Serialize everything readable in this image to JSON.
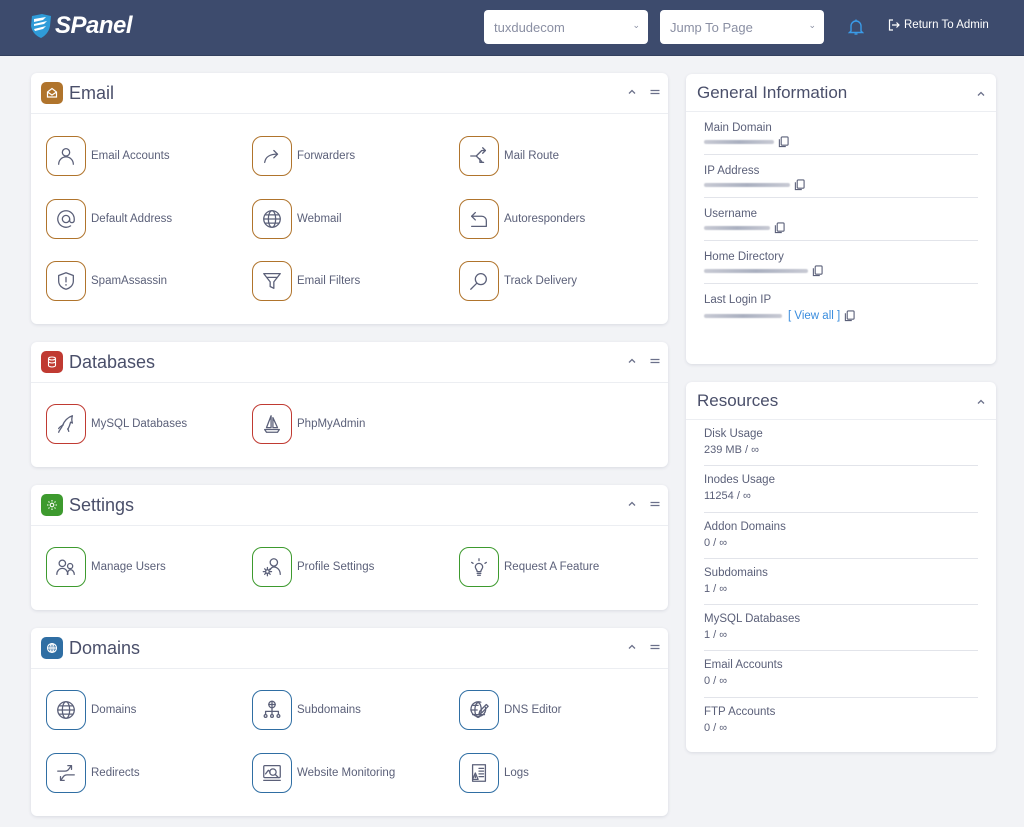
{
  "header": {
    "brand": "SPanel",
    "domain_select": {
      "value": "tuxdudecom",
      "caret": "⌄"
    },
    "jump_select": {
      "placeholder": "Jump To Page",
      "caret": "⌄"
    },
    "return_label": "Return To Admin"
  },
  "colors": {
    "email": "#b0742c",
    "databases": "#c03a32",
    "settings": "#3d9a2e",
    "domains": "#2f6ea3",
    "link": "#3a8dde",
    "topbar": "#3d4b6d"
  },
  "sections": {
    "email": {
      "title": "Email",
      "items": [
        {
          "label": "Email Accounts",
          "icon": "user-icon"
        },
        {
          "label": "Forwarders",
          "icon": "forward-arrow-icon"
        },
        {
          "label": "Mail Route",
          "icon": "route-split-icon"
        },
        {
          "label": "Default Address",
          "icon": "at-sign-icon"
        },
        {
          "label": "Webmail",
          "icon": "globe-icon"
        },
        {
          "label": "Autoresponders",
          "icon": "reply-arrow-icon"
        },
        {
          "label": "SpamAssassin",
          "icon": "shield-alert-icon"
        },
        {
          "label": "Email Filters",
          "icon": "funnel-icon"
        },
        {
          "label": "Track Delivery",
          "icon": "magnifier-icon"
        }
      ]
    },
    "databases": {
      "title": "Databases",
      "items": [
        {
          "label": "MySQL Databases",
          "icon": "dolphin-icon"
        },
        {
          "label": "PhpMyAdmin",
          "icon": "sailboat-icon"
        }
      ]
    },
    "settings": {
      "title": "Settings",
      "items": [
        {
          "label": "Manage Users",
          "icon": "users-icon"
        },
        {
          "label": "Profile Settings",
          "icon": "user-gear-icon"
        },
        {
          "label": "Request A Feature",
          "icon": "lightbulb-icon"
        }
      ]
    },
    "domains": {
      "title": "Domains",
      "items": [
        {
          "label": "Domains",
          "icon": "globe-icon"
        },
        {
          "label": "Subdomains",
          "icon": "network-icon"
        },
        {
          "label": "DNS Editor",
          "icon": "globe-edit-icon"
        },
        {
          "label": "Redirects",
          "icon": "redirect-arrows-icon"
        },
        {
          "label": "Website Monitoring",
          "icon": "monitor-search-icon"
        },
        {
          "label": "Logs",
          "icon": "log-file-icon"
        }
      ]
    }
  },
  "general_info": {
    "title": "General Information",
    "rows": [
      {
        "label": "Main Domain",
        "value": ""
      },
      {
        "label": "IP Address",
        "value": ""
      },
      {
        "label": "Username",
        "value": ""
      },
      {
        "label": "Home Directory",
        "value": ""
      },
      {
        "label": "Last Login IP",
        "value": "",
        "link": "[ View all ]"
      }
    ]
  },
  "resources": {
    "title": "Resources",
    "rows": [
      {
        "label": "Disk Usage",
        "value": "239 MB / ∞"
      },
      {
        "label": "Inodes Usage",
        "value": "11254 / ∞"
      },
      {
        "label": "Addon Domains",
        "value": "0 / ∞"
      },
      {
        "label": "Subdomains",
        "value": "1 / ∞"
      },
      {
        "label": "MySQL Databases",
        "value": "1 / ∞"
      },
      {
        "label": "Email Accounts",
        "value": "0 / ∞"
      },
      {
        "label": "FTP Accounts",
        "value": "0 / ∞"
      }
    ]
  }
}
